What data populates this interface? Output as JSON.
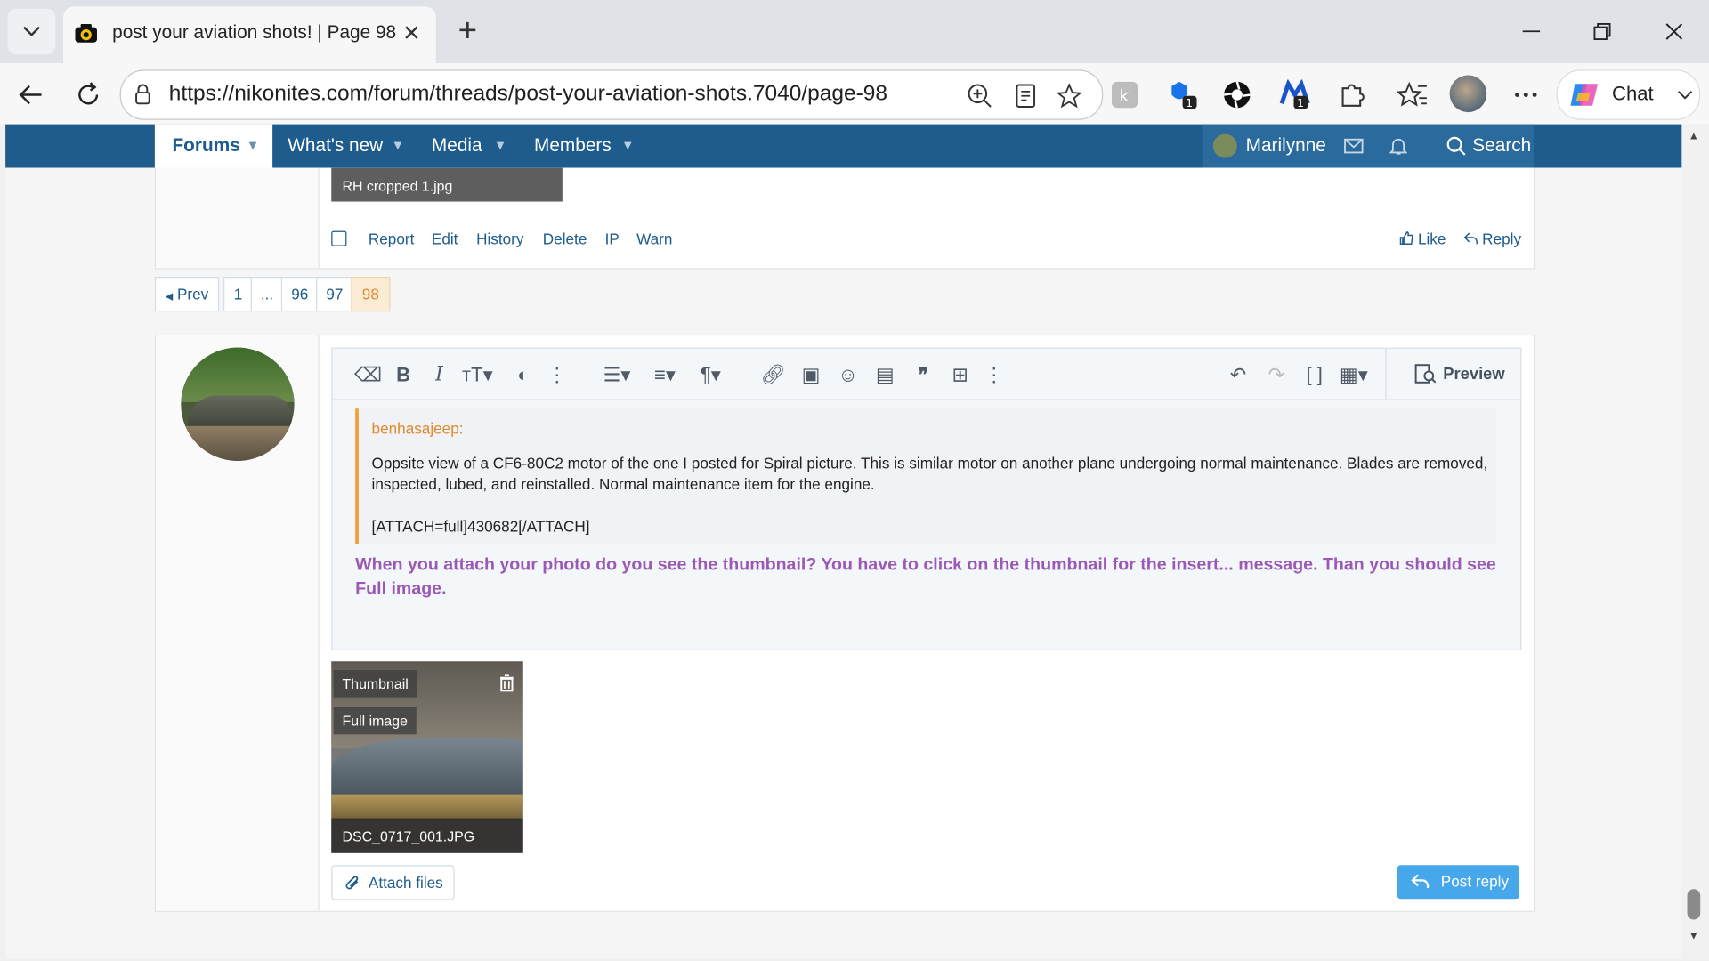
{
  "browser": {
    "tab_title": "post your aviation shots! | Page 98",
    "url": "https://nikonites.com/forum/threads/post-your-aviation-shots.7040/page-98",
    "chat_label": "Chat",
    "ext_badge_1": "1",
    "ext_badge_2": "1"
  },
  "forum_nav": {
    "items": [
      "Forums",
      "What's new",
      "Media",
      "Members"
    ],
    "user": "Marilynne",
    "search_label": "Search"
  },
  "prev_post": {
    "attachment_name": "RH cropped 1.jpg",
    "actions": [
      "Report",
      "Edit",
      "History",
      "Delete",
      "IP",
      "Warn"
    ],
    "like_label": "Like",
    "reply_label": "Reply"
  },
  "pagination": {
    "prev_label": "Prev",
    "pages": [
      "1",
      "...",
      "96",
      "97",
      "98"
    ],
    "current": "98"
  },
  "editor": {
    "preview_label": "Preview",
    "quote_author": "benhasajeep:",
    "quote_body": "Oppsite view of a CF6-80C2 motor of the one I posted for Spiral picture.  This is similar motor on another plane undergoing normal maintenance.  Blades are removed, inspected, lubed, and reinstalled.  Normal maintenance item for the engine.",
    "quote_attach": "[ATTACH=full]430682[/ATTACH]",
    "reply_text": "When you attach your photo do you see the thumbnail?  You have to click on the thumbnail for the insert... message.  Than you should see Full image."
  },
  "attachment": {
    "thumbnail_label": "Thumbnail",
    "full_image_label": "Full image",
    "filename": "DSC_0717_001.JPG"
  },
  "buttons": {
    "attach_files": "Attach files",
    "post_reply": "Post reply"
  },
  "colors": {
    "nav_bar": "#1d5c8d",
    "quote_accent": "#f0a030",
    "reply_text": "#9b59b6",
    "post_button": "#47a7eb"
  }
}
